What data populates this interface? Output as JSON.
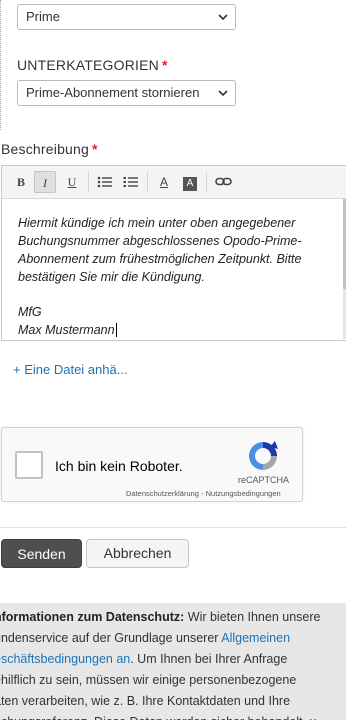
{
  "category": {
    "selected": "Prime"
  },
  "subcategory": {
    "label": "UNTERKATEGORIEN",
    "required_mark": "*",
    "selected": "Prime-Abonnement stornieren"
  },
  "description": {
    "label": "Beschreibung",
    "required_mark": "*",
    "toolbar": {
      "bold": "B",
      "italic": "I",
      "underline": "U",
      "text_color": "A",
      "bg_color": "A"
    },
    "lines": [
      "Hiermit kündige ich mein unter oben angegebener",
      "Buchungsnummer abgeschlossenes Opodo-Prime-",
      "Abonnement zum frühestmöglichen Zeitpunkt. Bitte",
      "bestätigen Sie mir die Kündigung."
    ],
    "sign_off": "MfG",
    "name": "Max Mustermann"
  },
  "attach": {
    "label": "+ Eine Datei anhä..."
  },
  "captcha": {
    "text": "Ich bin kein Roboter.",
    "brand": "reCAPTCHA",
    "terms": "Datenschutzerklärung - Nutzungsbedingungen"
  },
  "actions": {
    "send": "Senden",
    "cancel": "Abbrechen"
  },
  "privacy": {
    "line1_bold": "nformationen zum Datenschutz:",
    "line1_rest": " Wir bieten Ihnen unsere",
    "line2_pre": "undenservice auf der Grundlage unserer ",
    "line2_link": "Allgemeinen",
    "line3_link": "eschäftsbedingungen an",
    "line3_rest": ". Um Ihnen bei Ihrer Anfrage",
    "line4": "ehilflich zu sein, müssen wir einige personenbezogene",
    "line5": "aten verarbeiten, wie z. B. Ihre Kontaktdaten und Ihre",
    "line6": "uchungsreferenz. Diese Daten werden sicher behandelt, u"
  },
  "colors": {
    "required": "#d9232d",
    "link": "#1a73b8",
    "send_bg": "#4f4f4f",
    "privacy_bg": "#e7e7e7"
  }
}
